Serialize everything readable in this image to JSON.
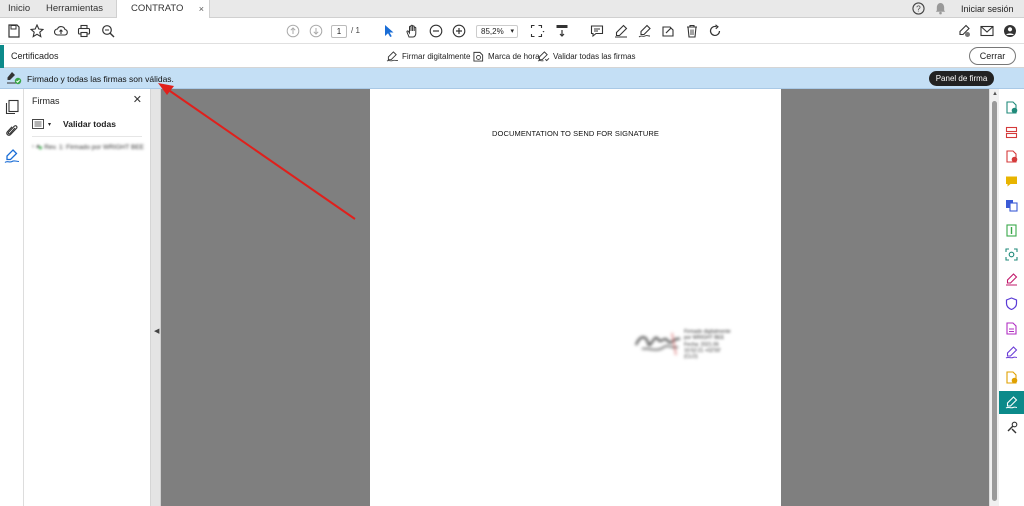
{
  "tabs": {
    "home": "Inicio",
    "tools": "Herramientas",
    "document": "CONTRATO PRU...",
    "close": "×"
  },
  "header_right": {
    "help_icon": "help-icon",
    "bell_icon": "bell-icon",
    "signin": "Iniciar sesión"
  },
  "toolbar": {
    "page_current": "1",
    "page_total": "/ 1",
    "zoom": "85,2%",
    "zoom_caret": "▾"
  },
  "cert_bar": {
    "title": "Certificados",
    "sign_digitally": "Firmar digitalmente",
    "timestamp": "Marca de hora",
    "validate_all": "Validar todas las firmas",
    "close": "Cerrar"
  },
  "sig_bar": {
    "message": "Firmado y todas las firmas son válidas.",
    "panel_button": "Panel de firma"
  },
  "sig_panel": {
    "title": "Firmas",
    "close": "✕",
    "validate_all": "Validar todas",
    "entry": "Rev. 1: Firmado por WRIGHT BEE"
  },
  "document": {
    "title": "DOCUMENTATION TO SEND FOR SIGNATURE",
    "signature_lines": [
      "Firmado digitalmente",
      "por WRIGHT BEE",
      "Fecha: 2021.06",
      "10:52:21 +02'00'",
      "(CLO)"
    ]
  },
  "colors": {
    "accent_teal": "#0c8a8a",
    "sig_bar_bg": "#c4dff5",
    "doc_bg": "#7f7f7f",
    "annotation_arrow": "#e0201c"
  }
}
